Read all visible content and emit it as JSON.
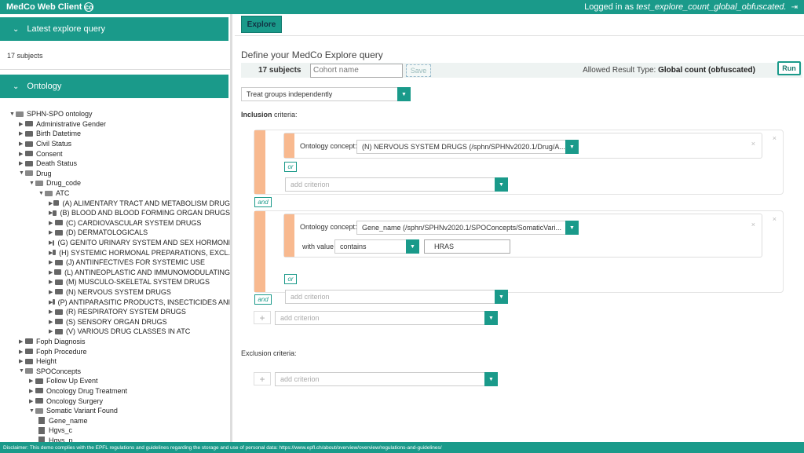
{
  "app": {
    "title": "MedCo Web Client",
    "logo": "co"
  },
  "header": {
    "logged_prefix": "Logged in as",
    "username": "test_explore_count_global_obfuscated."
  },
  "left": {
    "latest": {
      "title": "Latest explore query",
      "subjects": "17 subjects"
    },
    "ontology": {
      "title": "Ontology"
    },
    "tree": [
      {
        "label": "SPHN-SPO ontology",
        "depth": 0,
        "open": true,
        "type": "folder"
      },
      {
        "label": "Administrative Gender",
        "depth": 1,
        "open": false,
        "type": "folder"
      },
      {
        "label": "Birth Datetime",
        "depth": 1,
        "open": false,
        "type": "folder"
      },
      {
        "label": "Civil Status",
        "depth": 1,
        "open": false,
        "type": "folder"
      },
      {
        "label": "Consent",
        "depth": 1,
        "open": false,
        "type": "folder"
      },
      {
        "label": "Death Status",
        "depth": 1,
        "open": false,
        "type": "folder"
      },
      {
        "label": "Drug",
        "depth": 1,
        "open": true,
        "type": "folder"
      },
      {
        "label": "Drug_code",
        "depth": 2,
        "open": true,
        "type": "folder"
      },
      {
        "label": "ATC",
        "depth": 3,
        "open": true,
        "type": "folder"
      },
      {
        "label": "(A) ALIMENTARY TRACT AND METABOLISM DRUG",
        "depth": 4,
        "open": false,
        "type": "folder"
      },
      {
        "label": "(B) BLOOD AND BLOOD FORMING ORGAN DRUGS",
        "depth": 4,
        "open": false,
        "type": "folder"
      },
      {
        "label": "(C) CARDIOVASCULAR SYSTEM DRUGS",
        "depth": 4,
        "open": false,
        "type": "folder"
      },
      {
        "label": "(D) DERMATOLOGICALS",
        "depth": 4,
        "open": false,
        "type": "folder"
      },
      {
        "label": "(G) GENITO URINARY SYSTEM AND SEX HORMONI",
        "depth": 4,
        "open": false,
        "type": "folder"
      },
      {
        "label": "(H) SYSTEMIC HORMONAL PREPARATIONS, EXCL.",
        "depth": 4,
        "open": false,
        "type": "folder"
      },
      {
        "label": "(J) ANTIINFECTIVES FOR SYSTEMIC USE",
        "depth": 4,
        "open": false,
        "type": "folder"
      },
      {
        "label": "(L) ANTINEOPLASTIC AND IMMUNOMODULATING",
        "depth": 4,
        "open": false,
        "type": "folder"
      },
      {
        "label": "(M) MUSCULO-SKELETAL SYSTEM DRUGS",
        "depth": 4,
        "open": false,
        "type": "folder"
      },
      {
        "label": "(N) NERVOUS SYSTEM DRUGS",
        "depth": 4,
        "open": false,
        "type": "folder"
      },
      {
        "label": "(P) ANTIPARASITIC PRODUCTS, INSECTICIDES ANI",
        "depth": 4,
        "open": false,
        "type": "folder"
      },
      {
        "label": "(R) RESPIRATORY SYSTEM DRUGS",
        "depth": 4,
        "open": false,
        "type": "folder"
      },
      {
        "label": "(S) SENSORY ORGAN DRUGS",
        "depth": 4,
        "open": false,
        "type": "folder"
      },
      {
        "label": "(V) VARIOUS DRUG CLASSES IN ATC",
        "depth": 4,
        "open": false,
        "type": "folder"
      },
      {
        "label": "Foph Diagnosis",
        "depth": 1,
        "open": false,
        "type": "folder"
      },
      {
        "label": "Foph Procedure",
        "depth": 1,
        "open": false,
        "type": "folder"
      },
      {
        "label": "Height",
        "depth": 1,
        "open": false,
        "type": "folder"
      },
      {
        "label": "SPOConcepts",
        "depth": 1,
        "open": true,
        "type": "folder"
      },
      {
        "label": "Follow Up Event",
        "depth": 2,
        "open": false,
        "type": "folder"
      },
      {
        "label": "Oncology Drug Treatment",
        "depth": 2,
        "open": false,
        "type": "folder"
      },
      {
        "label": "Oncology Surgery",
        "depth": 2,
        "open": false,
        "type": "folder"
      },
      {
        "label": "Somatic Variant Found",
        "depth": 2,
        "open": true,
        "type": "folder"
      },
      {
        "label": "Gene_name",
        "depth": 3,
        "type": "leaf"
      },
      {
        "label": "Hgvs_c",
        "depth": 3,
        "type": "leaf"
      },
      {
        "label": "Hgvs_p",
        "depth": 3,
        "type": "leaf"
      }
    ]
  },
  "main": {
    "tab": "Explore",
    "title": "Define your MedCo Explore query",
    "subjects": "17 subjects",
    "cohort_placeholder": "Cohort name",
    "save": "Save",
    "allowed_prefix": "Allowed Result Type:",
    "allowed_value": "Global count (obfuscated)",
    "run": "Run",
    "groups_mode": "Treat groups independently",
    "inclusion_bold": "Inclusion",
    "inclusion_rest": " criteria:",
    "exclusion_label": "Exclusion criteria:",
    "concept_label": "Ontology concept:",
    "concept1": "(N) NERVOUS SYSTEM DRUGS (/sphn/SPHNv2020.1/Drug/A...",
    "concept2": "Gene_name (/sphn/SPHNv2020.1/SPOConcepts/SomaticVari...",
    "with_value": "with value",
    "operator": "contains",
    "value": "HRAS",
    "or": "or",
    "and": "and",
    "add_criterion": "add criterion",
    "close": "×",
    "plus": "+"
  },
  "footer": "Disclaimer: This demo complies with the EPFL regulations and guidelines regarding the storage and use of personal data: https://www.epfl.ch/about/overview/overview/regulations-and-guidelines/",
  "colors": {
    "teal": "#1a9a8a",
    "peach": "#f8b98f"
  }
}
